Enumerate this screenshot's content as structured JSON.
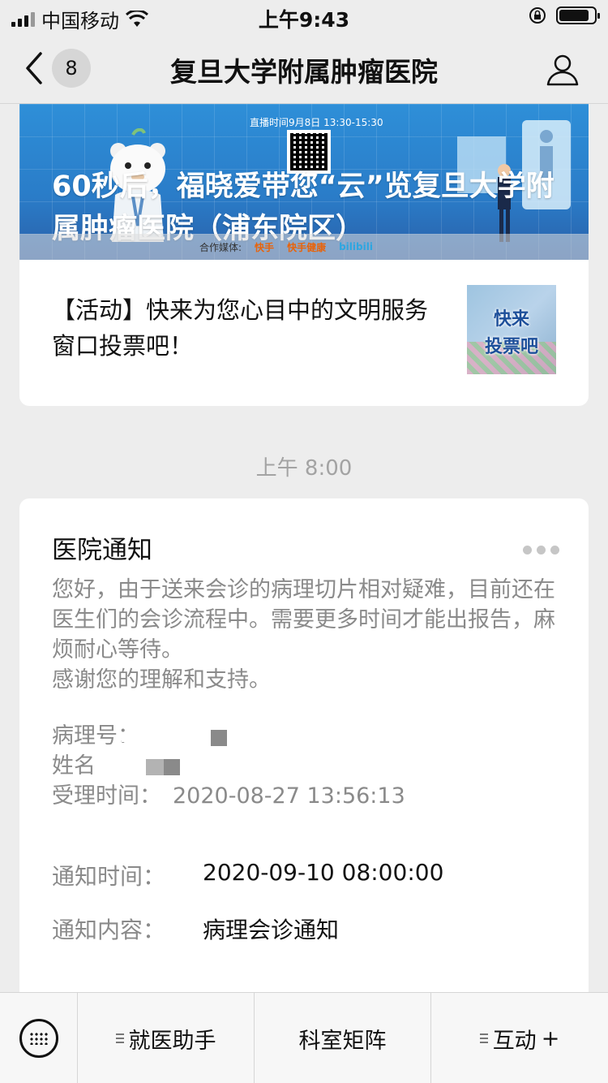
{
  "status_bar": {
    "carrier": "中国移动",
    "time": "上午9:43"
  },
  "nav": {
    "unread_count": "8",
    "title": "复旦大学附属肿瘤医院"
  },
  "article": {
    "banner_small_text": "直播时间9月8日 13:30-15:30",
    "banner_title": "60秒后，福晓爱带您“云”览复旦大学附属肿瘤医院（浦东院区）",
    "banner_partners_label": "合作媒体:",
    "partner_1": "快手",
    "partner_2": "快手健康",
    "partner_3": "bilibili",
    "item_title": "【活动】快来为您心目中的文明服务窗口投票吧！",
    "thumb_line_1": "快来",
    "thumb_line_2": "投票吧"
  },
  "timestamp": "上午 8:00",
  "notice": {
    "title": "医院通知",
    "body_1": "您好，由于送来会诊的病理切片相对疑难，目前还在医生们的会诊流程中。需要更多时间才能出报告，麻烦耐心等待。",
    "body_2": "感谢您的理解和支持。",
    "field_pathology_label": "病理号：",
    "field_name_label": "姓名",
    "field_accept_label": "受理时间：",
    "field_accept_value": "2020-08-27 13:56:13",
    "notify_time_label": "通知时间：",
    "notify_time_value": "2020-09-10 08:00:00",
    "notify_content_label": "通知内容：",
    "notify_content_value": "病理会诊通知"
  },
  "bottom_menu": {
    "items": [
      {
        "label": "就医助手"
      },
      {
        "label": "科室矩阵"
      },
      {
        "label": "互动",
        "suffix": "+"
      }
    ]
  }
}
